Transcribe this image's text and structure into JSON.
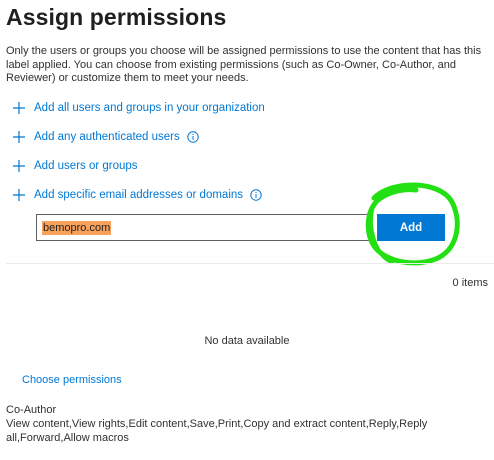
{
  "header": {
    "title": "Assign permissions"
  },
  "description": "Only the users or groups you choose will be assigned permissions to use the content that has this label applied. You can choose from existing permissions (such as Co-Owner, Co-Author, and Reviewer) or customize them to meet your needs.",
  "actions": {
    "add_all": "Add all users and groups in your organization",
    "add_authenticated": "Add any authenticated users",
    "add_users_groups": "Add users or groups",
    "add_specific": "Add specific email addresses or domains"
  },
  "email_input": {
    "value": "bemopro.com"
  },
  "add_button": {
    "label": "Add"
  },
  "list": {
    "count": "0 items",
    "empty_text": "No data available"
  },
  "permissions": {
    "choose_label": "Choose permissions",
    "name": "Co-Author",
    "rights": "View content,View rights,Edit content,Save,Print,Copy and extract content,Reply,Reply all,Forward,Allow macros"
  },
  "colors": {
    "accent": "#0078d4",
    "highlight": "#f7a15a",
    "annotation": "#22e012"
  },
  "icons": [
    "plus-icon",
    "info-icon"
  ]
}
